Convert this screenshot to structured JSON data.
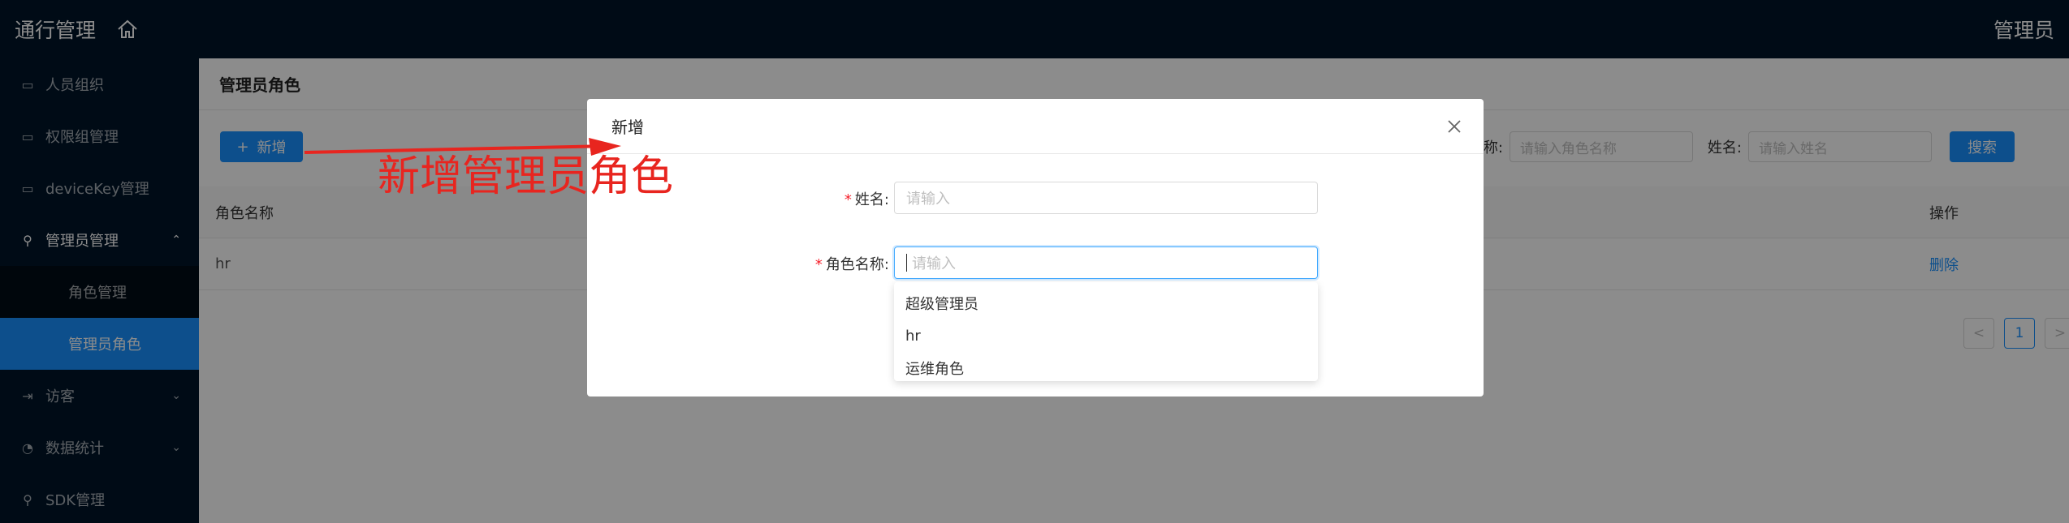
{
  "header": {
    "app_title": "通行管理",
    "user": "管理员"
  },
  "sidebar": {
    "items": [
      {
        "label": "人员组织"
      },
      {
        "label": "权限组管理"
      },
      {
        "label": "deviceKey管理"
      },
      {
        "label": "管理员管理"
      },
      {
        "label": "角色管理"
      },
      {
        "label": "管理员角色"
      },
      {
        "label": "访客"
      },
      {
        "label": "数据统计"
      },
      {
        "label": "SDK管理"
      }
    ]
  },
  "page": {
    "title": "管理员角色",
    "add_button": "新增",
    "search": {
      "role_label": "色名称:",
      "role_placeholder": "请输入角色名称",
      "name_label": "姓名:",
      "name_placeholder": "请输入姓名",
      "search_button": "搜索"
    },
    "table": {
      "columns": [
        "角色名称",
        "操作"
      ],
      "rows": [
        {
          "role": "hr",
          "action": "删除"
        }
      ]
    },
    "pagination": {
      "prev": "<",
      "current": "1",
      "next": ">"
    }
  },
  "modal": {
    "title": "新增",
    "name_label": "姓名:",
    "name_placeholder": "请输入",
    "role_label": "角色名称:",
    "role_placeholder": "请输入",
    "required_mark": "*",
    "options": [
      "超级管理员",
      "hr",
      "运维角色"
    ]
  },
  "annotation": {
    "text": "新增管理员角色",
    "color": "#e8251f"
  },
  "colors": {
    "primary": "#1890ff",
    "sidebar_bg": "#001529"
  }
}
